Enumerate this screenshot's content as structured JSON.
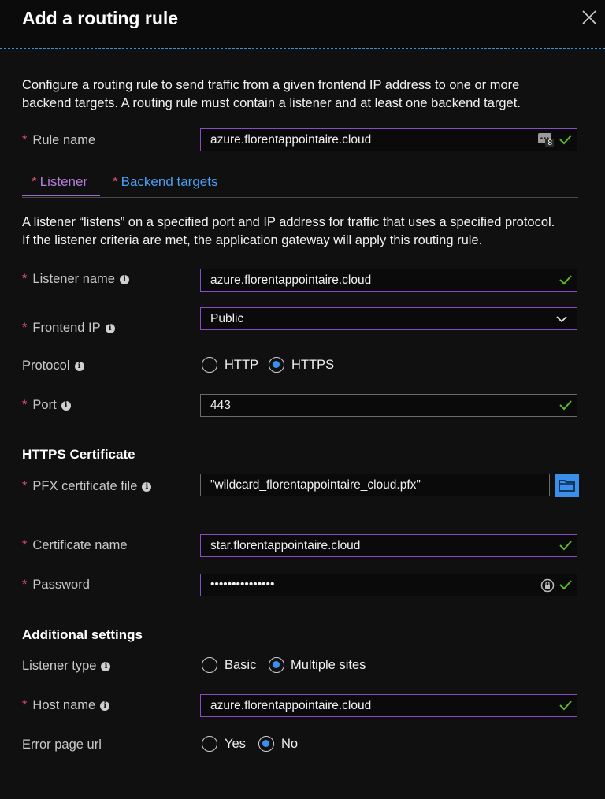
{
  "panel": {
    "title": "Add a routing rule"
  },
  "intro": {
    "line1": "Configure a routing rule to send traffic from a given frontend IP address to one or more",
    "line2": "backend targets. A routing rule must contain a listener and at least one backend target."
  },
  "rule_name": {
    "label": "Rule name",
    "value": "azure.florentappointaire.cloud",
    "badge": "8"
  },
  "tabs": [
    {
      "label": "Listener",
      "selected": true
    },
    {
      "label": "Backend targets",
      "selected": false
    }
  ],
  "listener_desc": {
    "line1": "A listener “listens” on a specified port and IP address for traffic that uses a specified protocol.",
    "line2": "If the listener criteria are met, the application gateway will apply this routing rule."
  },
  "listener_name": {
    "label": "Listener name",
    "value": "azure.florentappointaire.cloud"
  },
  "frontend_ip": {
    "label": "Frontend IP",
    "value": "Public"
  },
  "protocol": {
    "label": "Protocol",
    "options": [
      "HTTP",
      "HTTPS"
    ],
    "selected": "HTTPS"
  },
  "port": {
    "label": "Port",
    "value": "443"
  },
  "https_cert": {
    "heading": "HTTPS Certificate",
    "pfx_label": "PFX certificate file",
    "pfx_value": "\"wildcard_florentappointaire_cloud.pfx\"",
    "cert_name_label": "Certificate name",
    "cert_name_value": "star.florentappointaire.cloud",
    "password_label": "Password",
    "password_value": "•••••••••••••••"
  },
  "additional": {
    "heading": "Additional settings",
    "listener_type_label": "Listener type",
    "listener_type_options": [
      "Basic",
      "Multiple sites"
    ],
    "listener_type_selected": "Multiple sites",
    "host_name_label": "Host name",
    "host_name_value": "azure.florentappointaire.cloud",
    "error_page_label": "Error page url",
    "error_page_options": [
      "Yes",
      "No"
    ],
    "error_page_selected": "No"
  },
  "colors": {
    "accent_purple": "#8a4bc8",
    "accent_blue": "#3b8ff0",
    "valid_green": "#5fb832",
    "required_red": "#e0506b"
  },
  "icons": [
    "close-icon",
    "info-icon",
    "valid-check-icon",
    "chevron-down-icon",
    "folder-icon",
    "password-reveal-icon",
    "password-generator-icon"
  ]
}
